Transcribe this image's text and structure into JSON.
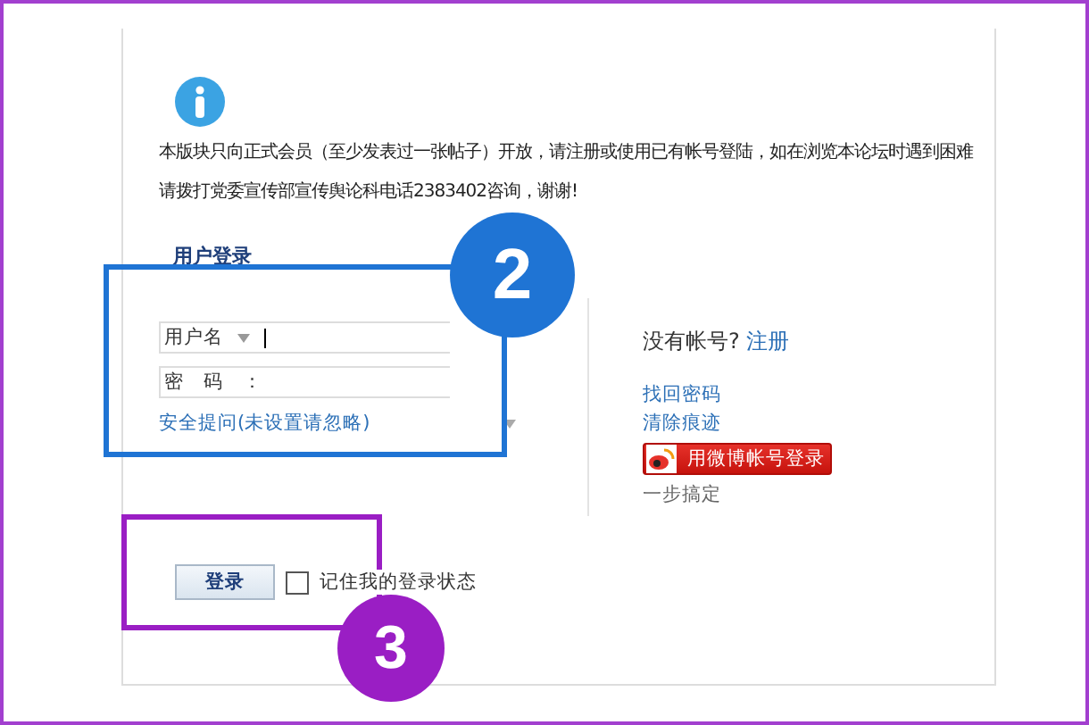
{
  "notice": {
    "lines": [
      "本版块只向正式会员（至少发表过一张帖子）开放，请注册或使用已有帐号登陆，如在浏览本论坛时遇到困难",
      "请拨打党委宣传部宣传舆论科电话2383402咨询，谢谢!"
    ]
  },
  "login": {
    "title": "用户登录",
    "fields": [
      {
        "label": "用户名",
        "kind": "select"
      },
      {
        "label": "密　码　：",
        "kind": "plain"
      }
    ],
    "question": "安全提问(未设置请忽略)",
    "submit": "登录",
    "remember": {
      "label": "记住我的登录状态",
      "checked": false
    }
  },
  "side": {
    "prompt": "没有帐号?",
    "register": "注册",
    "links": [
      "找回密码",
      "清除痕迹"
    ],
    "weibo_button": "用微博帐号登录",
    "weibo_note": "一步搞定"
  },
  "annotations": [
    {
      "number": "2",
      "color": "#1f74d4"
    },
    {
      "number": "3",
      "color": "#9a1ec4"
    }
  ]
}
